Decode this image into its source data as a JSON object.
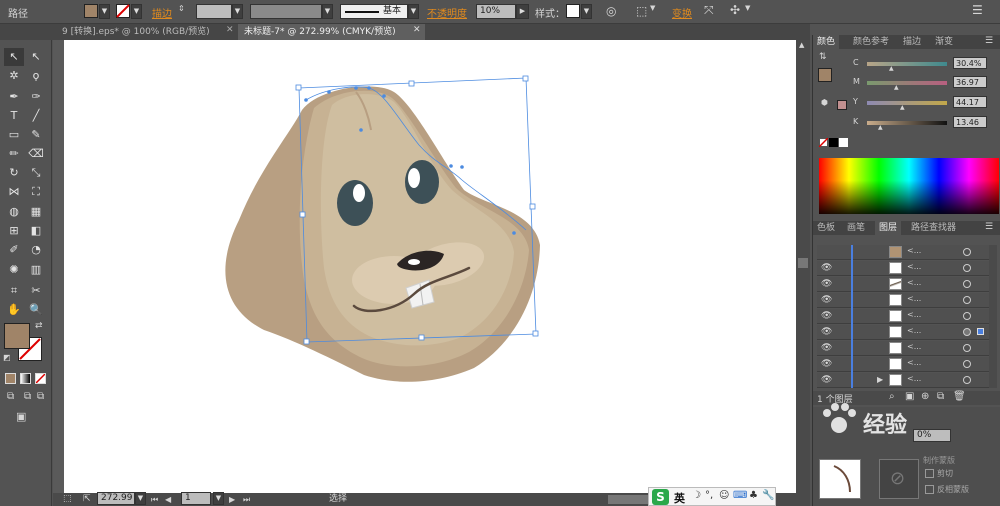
{
  "control_bar": {
    "object_type": "路径",
    "stroke_label": "描边",
    "stroke_style": "基本",
    "opacity_label": "不透明度",
    "opacity_value": "10%",
    "style_label": "样式",
    "transform_label": "变换"
  },
  "doc_tabs": [
    {
      "label": "9 [转换].eps* @ 100% (RGB/预览)"
    },
    {
      "label": "未标题-7* @ 272.99% (CMYK/预览)"
    }
  ],
  "status_bar": {
    "zoom": "272.99",
    "page": "1",
    "tool_name": "选择"
  },
  "color_panel": {
    "tabs": [
      "颜色",
      "颜色参考",
      "描边",
      "渐变"
    ],
    "sliders": [
      {
        "label": "C",
        "value": "30.4%"
      },
      {
        "label": "M",
        "value": "36.97"
      },
      {
        "label": "Y",
        "value": "44.17"
      },
      {
        "label": "K",
        "value": "13.46"
      }
    ],
    "fill_color": "#a08468"
  },
  "layers_panel": {
    "tabs": [
      "色板",
      "画笔",
      "图层",
      "路径查找器"
    ],
    "row_label": "<...",
    "footer_count": "1 个图层"
  },
  "watermark": {
    "text": "经验"
  },
  "ime_bar": {
    "lang": "英"
  },
  "bottom_panel": {
    "clip_label": "剪切",
    "invert_label": "反相蒙版",
    "make_mask_label": "制作蒙版",
    "opacity_label": "0%"
  }
}
